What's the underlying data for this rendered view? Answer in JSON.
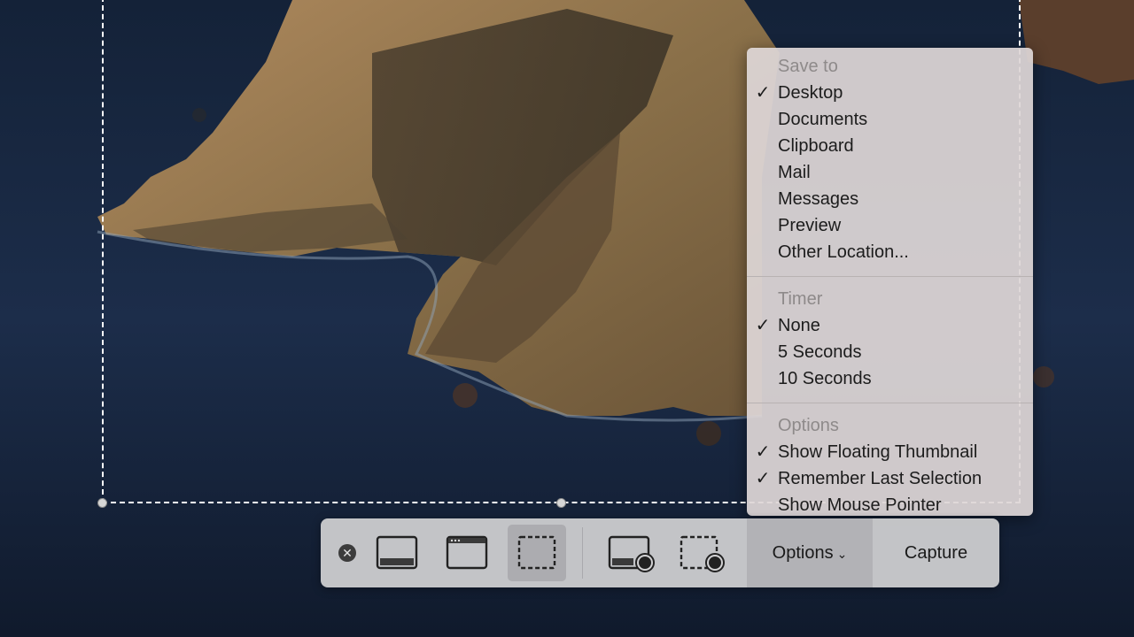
{
  "menu": {
    "sections": [
      {
        "header": "Save to",
        "items": [
          {
            "label": "Desktop",
            "checked": "✓"
          },
          {
            "label": "Documents",
            "checked": ""
          },
          {
            "label": "Clipboard",
            "checked": ""
          },
          {
            "label": "Mail",
            "checked": ""
          },
          {
            "label": "Messages",
            "checked": ""
          },
          {
            "label": "Preview",
            "checked": ""
          },
          {
            "label": "Other Location...",
            "checked": ""
          }
        ]
      },
      {
        "header": "Timer",
        "items": [
          {
            "label": "None",
            "checked": "✓"
          },
          {
            "label": "5 Seconds",
            "checked": ""
          },
          {
            "label": "10 Seconds",
            "checked": ""
          }
        ]
      },
      {
        "header": "Options",
        "items": [
          {
            "label": "Show Floating Thumbnail",
            "checked": "✓"
          },
          {
            "label": "Remember Last Selection",
            "checked": "✓"
          },
          {
            "label": "Show Mouse Pointer",
            "checked": ""
          }
        ]
      }
    ]
  },
  "toolbar": {
    "close_glyph": "✕",
    "buttons": [
      {
        "icon": "capture-entire-screen-icon"
      },
      {
        "icon": "capture-selected-window-icon"
      },
      {
        "icon": "capture-selected-portion-icon",
        "selected": true
      },
      {
        "icon": "record-entire-screen-icon"
      },
      {
        "icon": "record-selected-portion-icon"
      }
    ],
    "options_label": "Options",
    "options_chevron": "⌄",
    "capture_label": "Capture"
  },
  "colors": {
    "menu_bg": "#ded6d6",
    "toolbar_bg": "#d2d2d4",
    "header_text": "#8e8a8a",
    "ocean": "#1b2a45"
  }
}
